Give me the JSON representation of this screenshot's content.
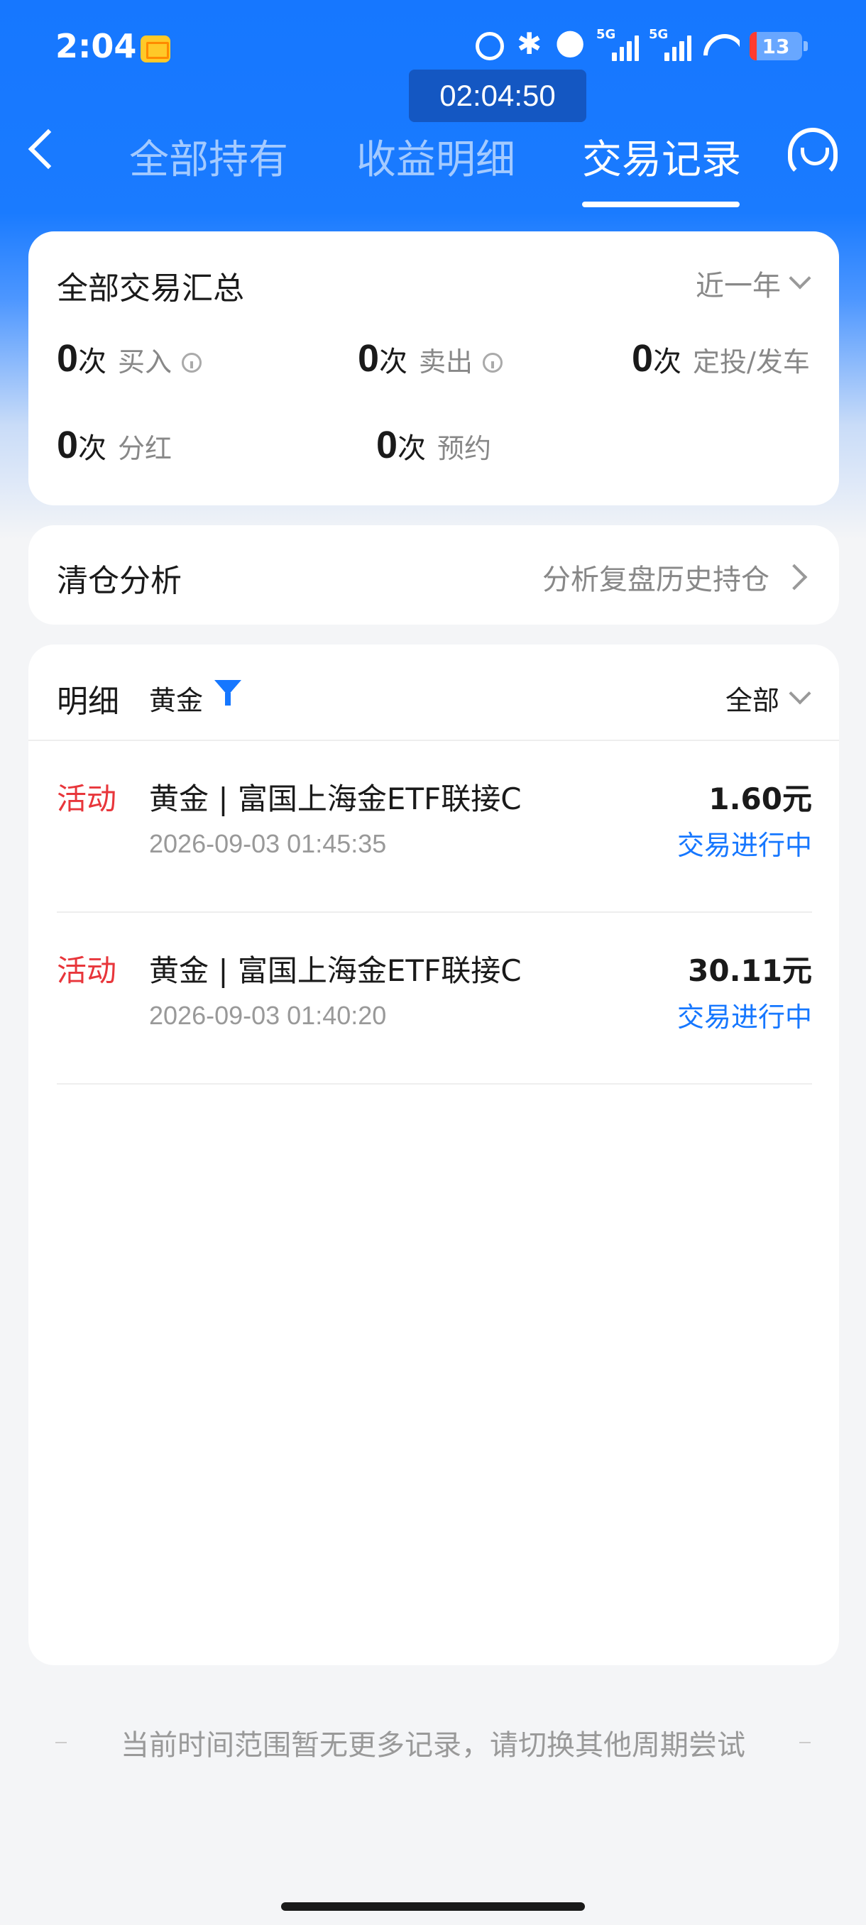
{
  "status_bar": {
    "time": "2:04",
    "signal_label_1": "5G",
    "signal_label_2": "5G",
    "battery": "13"
  },
  "timer": "02:04:50",
  "nav": {
    "tabs": [
      {
        "label": "全部持有"
      },
      {
        "label": "收益明细"
      },
      {
        "label": "交易记录"
      }
    ],
    "active_tab": "交易记录"
  },
  "summary": {
    "title": "全部交易汇总",
    "period": "近一年",
    "stats": [
      {
        "count": "0",
        "unit": "次",
        "label": "买入"
      },
      {
        "count": "0",
        "unit": "次",
        "label": "卖出"
      },
      {
        "count": "0",
        "unit": "次",
        "label": "定投/发车"
      },
      {
        "count": "0",
        "unit": "次",
        "label": "分红"
      },
      {
        "count": "0",
        "unit": "次",
        "label": "预约"
      }
    ]
  },
  "clearance": {
    "title": "清仓分析",
    "link": "分析复盘历史持仓"
  },
  "detail": {
    "title": "明细",
    "filter": "黄金",
    "scope": "全部",
    "transactions": [
      {
        "tag": "活动",
        "name": "黄金 | 富国上海金ETF联接C",
        "time": "2026-09-03 01:45:35",
        "amount": "1.60元",
        "status": "交易进行中"
      },
      {
        "tag": "活动",
        "name": "黄金 | 富国上海金ETF联接C",
        "time": "2026-09-03 01:40:20",
        "amount": "30.11元",
        "status": "交易进行中"
      }
    ]
  },
  "footer_note": "当前时间范围暂无更多记录，请切换其他周期尝试"
}
